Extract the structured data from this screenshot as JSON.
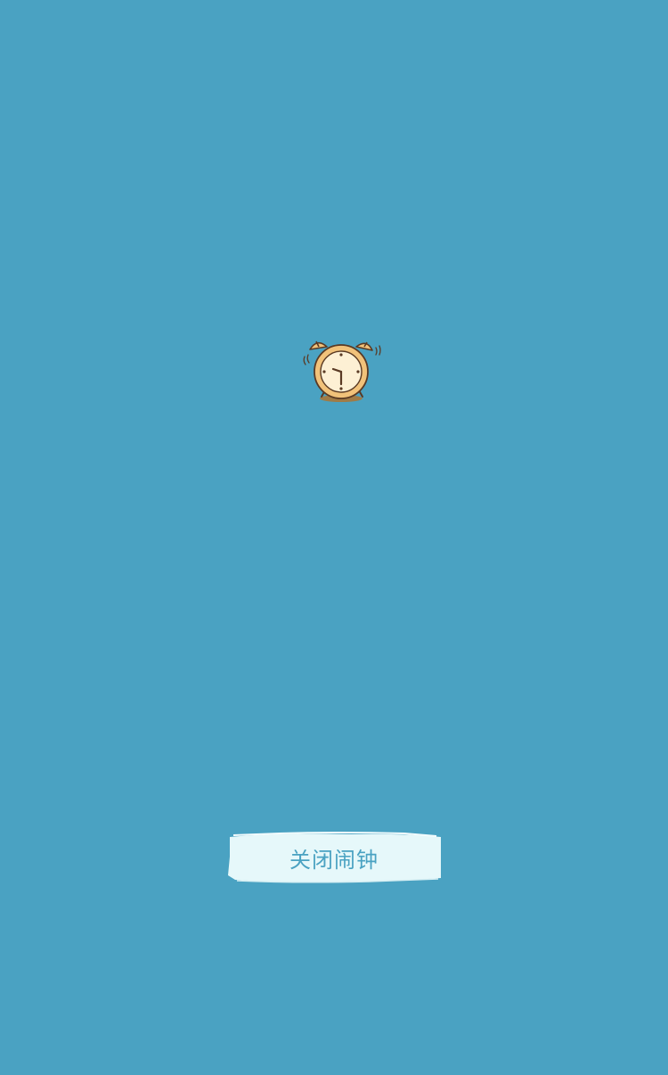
{
  "screen": {
    "background_color": "#4aa2c2"
  },
  "alarm": {
    "icon": "alarm-clock-icon",
    "ringing": true
  },
  "dismiss_button": {
    "label": "关闭闹钟",
    "bg_color": "#e8f8fa",
    "text_color": "#4aa2c2"
  }
}
